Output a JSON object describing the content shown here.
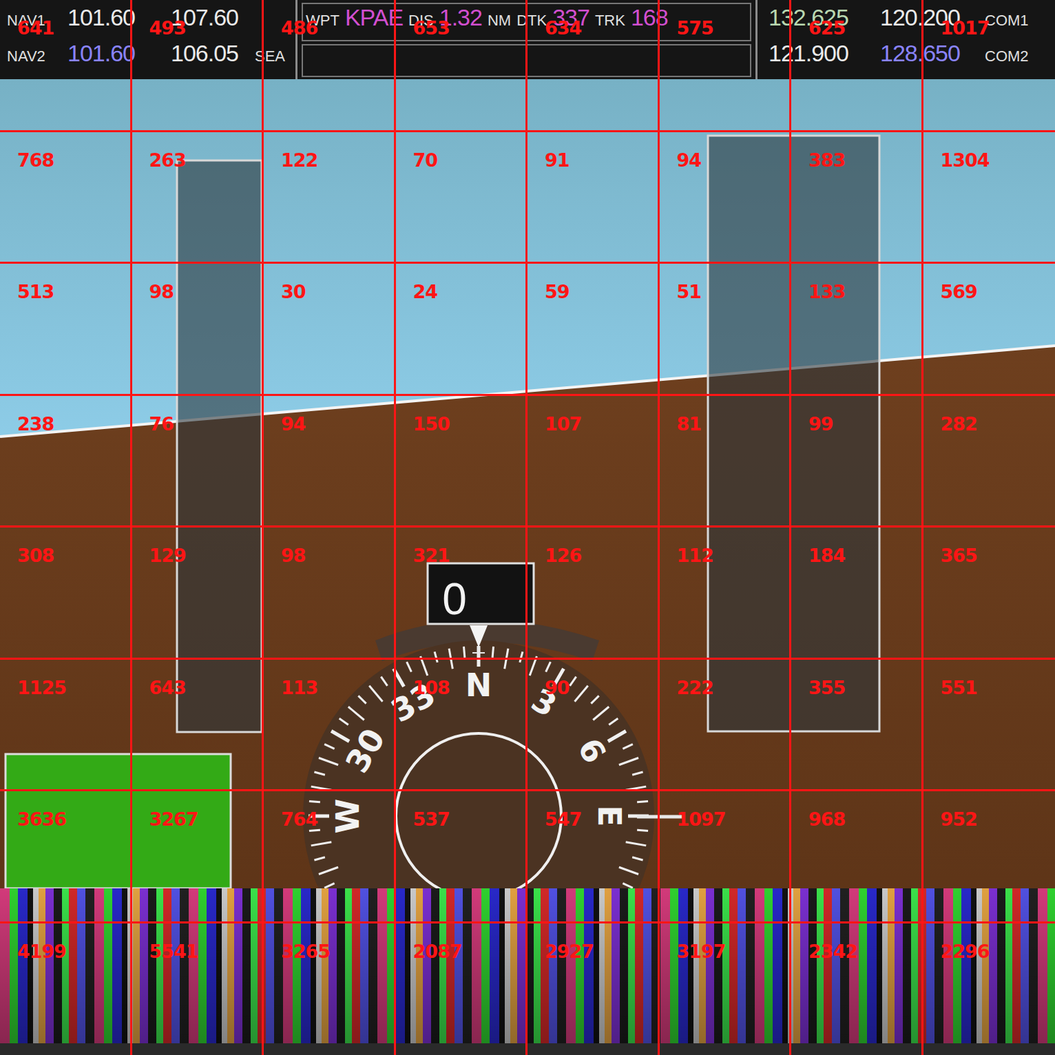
{
  "nav": [
    {
      "label": "NAV1",
      "active": "101.60",
      "standby": "107.60"
    },
    {
      "label": "NAV2",
      "active": "101.60",
      "standby": "106.05",
      "station": "SEA"
    }
  ],
  "waypoint": {
    "label": "WPT",
    "id": "KPAE",
    "dis_label": "DIS",
    "dis": "1.32",
    "dis_unit": "NM",
    "dtk_label": "DTK",
    "dtk": "337",
    "trk_label": "TRK",
    "trk": "168"
  },
  "com": [
    {
      "label": "COM1",
      "active": "132.625",
      "standby": "120.200"
    },
    {
      "label": "COM2",
      "active": "121.900",
      "standby": "128.650"
    }
  ],
  "heading": {
    "value": "0"
  },
  "compass_labels": [
    {
      "text": "N",
      "bearing": 0
    },
    {
      "text": "3",
      "bearing": 30
    },
    {
      "text": "6",
      "bearing": 60
    },
    {
      "text": "E",
      "bearing": 90
    },
    {
      "text": "W",
      "bearing": 270
    },
    {
      "text": "30",
      "bearing": 300
    },
    {
      "text": "33",
      "bearing": 330
    }
  ],
  "grid": [
    [
      "641",
      "493",
      "486",
      "653",
      "634",
      "575",
      "625",
      "1017"
    ],
    [
      "768",
      "263",
      "122",
      "70",
      "91",
      "94",
      "383",
      "1304"
    ],
    [
      "513",
      "98",
      "30",
      "24",
      "59",
      "51",
      "133",
      "569"
    ],
    [
      "238",
      "76",
      "94",
      "150",
      "107",
      "81",
      "99",
      "282"
    ],
    [
      "308",
      "129",
      "98",
      "321",
      "126",
      "112",
      "184",
      "365"
    ],
    [
      "1125",
      "643",
      "113",
      "108",
      "90",
      "222",
      "355",
      "551"
    ],
    [
      "3636",
      "3267",
      "764",
      "537",
      "547",
      "1097",
      "968",
      "952"
    ],
    [
      "4199",
      "5541",
      "3265",
      "2087",
      "2927",
      "3197",
      "2342",
      "2296"
    ]
  ]
}
